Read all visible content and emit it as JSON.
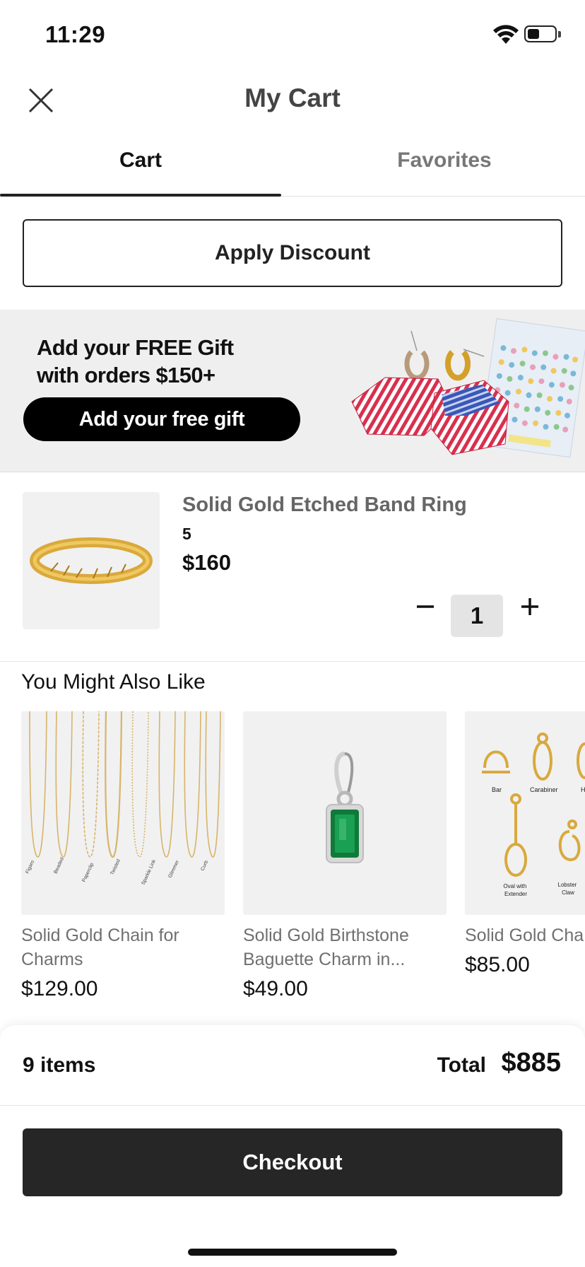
{
  "status_bar": {
    "time": "11:29",
    "battery_level": 0.45,
    "icons": [
      "wifi-icon",
      "battery-icon"
    ]
  },
  "header": {
    "title": "My Cart",
    "close_icon": "close-icon"
  },
  "tabs": [
    {
      "label": "Cart",
      "active": true
    },
    {
      "label": "Favorites",
      "active": false
    }
  ],
  "discount": {
    "label": "Apply Discount"
  },
  "gift_banner": {
    "line1": "Add your FREE Gift",
    "line2": "with orders $150+",
    "button_label": "Add your free gift"
  },
  "cart_item": {
    "name": "Solid Gold Etched Band Ring",
    "size": "5",
    "price": "$160",
    "quantity": "1",
    "minus_icon": "minus-icon",
    "plus_icon": "plus-icon"
  },
  "recommendations": {
    "title": "You Might Also Like",
    "items": [
      {
        "name": "Solid Gold Chain for Charms",
        "price": "$129.00",
        "chain_labels": [
          "Figaro",
          "Beaded",
          "Paperclip",
          "Twisted",
          "Sparkle Link",
          "Glimmer",
          "Curb"
        ]
      },
      {
        "name": "Solid Gold Birthstone Baguette Charm in...",
        "price": "$49.00"
      },
      {
        "name": "Solid Gold Cha",
        "price": "$85.00",
        "clasp_labels": [
          "Bar",
          "Carabiner",
          "H",
          "Oval with Extender",
          "Lobster Claw"
        ]
      }
    ]
  },
  "summary": {
    "items_count": "9 items",
    "total_label": "Total",
    "total_value": "$885",
    "checkout_label": "Checkout"
  },
  "colors": {
    "accent_dark": "#262626",
    "muted_text": "#707070",
    "banner_bg": "#efefef",
    "emerald": "#0f7a3a"
  }
}
